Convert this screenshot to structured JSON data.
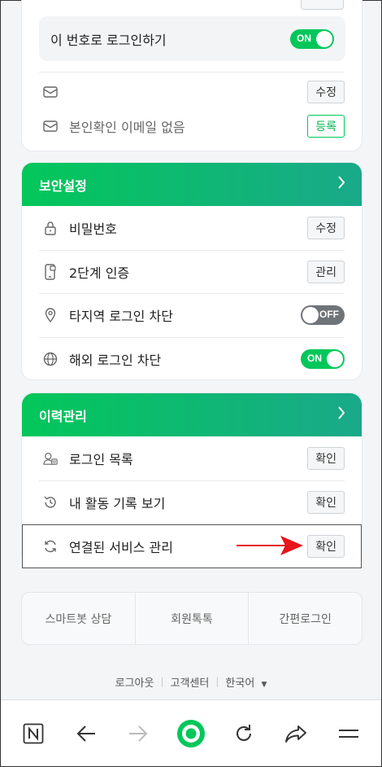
{
  "account": {
    "login_with_number_label": "이 번호로 로그인하기",
    "login_with_number_toggle": "ON",
    "email_empty_label": "",
    "email_empty_button": "수정",
    "verify_email_label": "본인확인 이메일 없음",
    "verify_email_button": "등록"
  },
  "security": {
    "title": "보안설정",
    "items": [
      {
        "label": "비밀번호",
        "button": "수정"
      },
      {
        "label": "2단계 인증",
        "button": "관리"
      },
      {
        "label": "타지역 로그인 차단",
        "toggle": "OFF"
      },
      {
        "label": "해외 로그인 차단",
        "toggle": "ON"
      }
    ]
  },
  "history": {
    "title": "이력관리",
    "items": [
      {
        "label": "로그인 목록",
        "button": "확인"
      },
      {
        "label": "내 활동 기록 보기",
        "button": "확인"
      },
      {
        "label": "연결된 서비스 관리",
        "button": "확인"
      }
    ]
  },
  "bottom_links": [
    "스마트봇 상담",
    "회원톡톡",
    "간편로그인"
  ],
  "footer": {
    "logout": "로그아웃",
    "support": "고객센터",
    "language": "한국어"
  },
  "colors": {
    "accent": "#03c75a",
    "accent_end": "#1aa98a",
    "toggle_off": "#6f7479",
    "arrow": "#e8141c"
  },
  "browser_nav": [
    "naver-n-icon",
    "back-arrow-icon",
    "forward-arrow-icon",
    "naver-home-icon",
    "refresh-icon",
    "share-icon",
    "menu-icon"
  ]
}
